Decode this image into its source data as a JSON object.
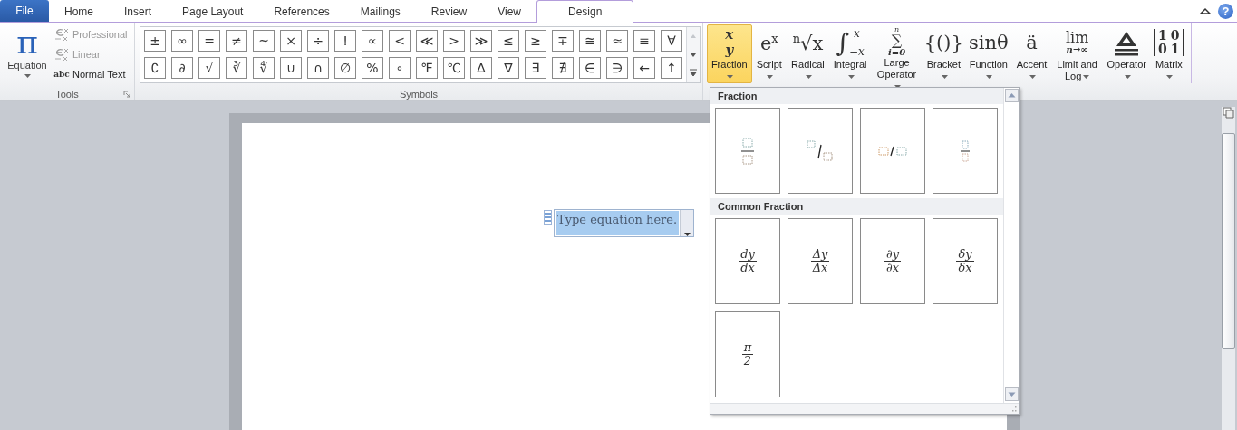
{
  "tabs": [
    {
      "label": "File",
      "kind": "file",
      "selected": false
    },
    {
      "label": "Home",
      "kind": "tab",
      "selected": false
    },
    {
      "label": "Insert",
      "kind": "tab",
      "selected": false
    },
    {
      "label": "Page Layout",
      "kind": "tab",
      "selected": false
    },
    {
      "label": "References",
      "kind": "tab",
      "selected": false
    },
    {
      "label": "Mailings",
      "kind": "tab",
      "selected": false
    },
    {
      "label": "Review",
      "kind": "tab",
      "selected": false
    },
    {
      "label": "View",
      "kind": "tab",
      "selected": false
    },
    {
      "label": "Design",
      "kind": "tab",
      "selected": true
    }
  ],
  "help": "?",
  "tools": {
    "label": "Tools",
    "equation": "Equation",
    "equation_icon": "π",
    "items": [
      {
        "label": "Professional",
        "kind": "professional",
        "disabled": true
      },
      {
        "label": "Linear",
        "kind": "linear",
        "disabled": true
      },
      {
        "label": "Normal Text",
        "kind": "normal",
        "icon_text": "abc",
        "disabled": false
      }
    ]
  },
  "symbols": {
    "label": "Symbols",
    "rows": [
      [
        "±",
        "∞",
        "=",
        "≠",
        "~",
        "×",
        "÷",
        "!",
        "∝",
        "<",
        "≪",
        ">",
        "≫",
        "≤",
        "≥",
        "∓",
        "≅",
        "≈",
        "≡",
        "∀"
      ],
      [
        "∁",
        "∂",
        "√",
        "∛",
        "∜",
        "∪",
        "∩",
        "∅",
        "%",
        "∘",
        "℉",
        "℃",
        "∆",
        "∇",
        "∃",
        "∄",
        "∈",
        "∋",
        "←",
        "↑"
      ]
    ]
  },
  "structures": [
    {
      "label": "Fraction",
      "kind": "fraction",
      "num": "x",
      "den": "y",
      "selected": true
    },
    {
      "label": "Script",
      "kind": "text",
      "glyph": "e$^{x}$",
      "selected": false
    },
    {
      "label": "Radical",
      "kind": "text",
      "glyph": "$^{n}$√x",
      "selected": false
    },
    {
      "label": "Integral",
      "kind": "integral",
      "symbol": "∫",
      "upper": "x",
      "lower": "−x",
      "selected": false
    },
    {
      "label": "Large Operator",
      "kind": "stack",
      "upper": "n",
      "symbol": "∑",
      "lower": "i=0",
      "selected": false
    },
    {
      "label": "Bracket",
      "kind": "text",
      "glyph": "{()}",
      "selected": false
    },
    {
      "label": "Function",
      "kind": "text",
      "glyph": "sinθ",
      "selected": false
    },
    {
      "label": "Accent",
      "kind": "text",
      "glyph": "ä",
      "selected": false
    },
    {
      "label": "Limit and Log",
      "kind": "stack",
      "symbol": "lim",
      "lower": "n→∞",
      "selected": false
    },
    {
      "label": "Operator",
      "kind": "operator",
      "selected": false
    },
    {
      "label": "Matrix",
      "kind": "matrix",
      "rows": [
        [
          "1",
          "0"
        ],
        [
          "0",
          "1"
        ]
      ],
      "selected": false
    }
  ],
  "gallery": {
    "sections": [
      {
        "title": "Fraction",
        "items": [
          {
            "kind": "stacked"
          },
          {
            "kind": "skewed"
          },
          {
            "kind": "linear"
          },
          {
            "kind": "small"
          }
        ]
      },
      {
        "title": "Common Fraction",
        "items": [
          {
            "kind": "fraction",
            "num": "dy",
            "den": "dx"
          },
          {
            "kind": "fraction",
            "num": "Δy",
            "den": "Δx"
          },
          {
            "kind": "fraction",
            "num": "∂y",
            "den": "∂x"
          },
          {
            "kind": "fraction",
            "num": "δy",
            "den": "δx"
          },
          {
            "kind": "fraction",
            "num": "π",
            "den": "2"
          }
        ]
      }
    ]
  },
  "equation": {
    "placeholder": "Type equation here.",
    "selected": true
  }
}
